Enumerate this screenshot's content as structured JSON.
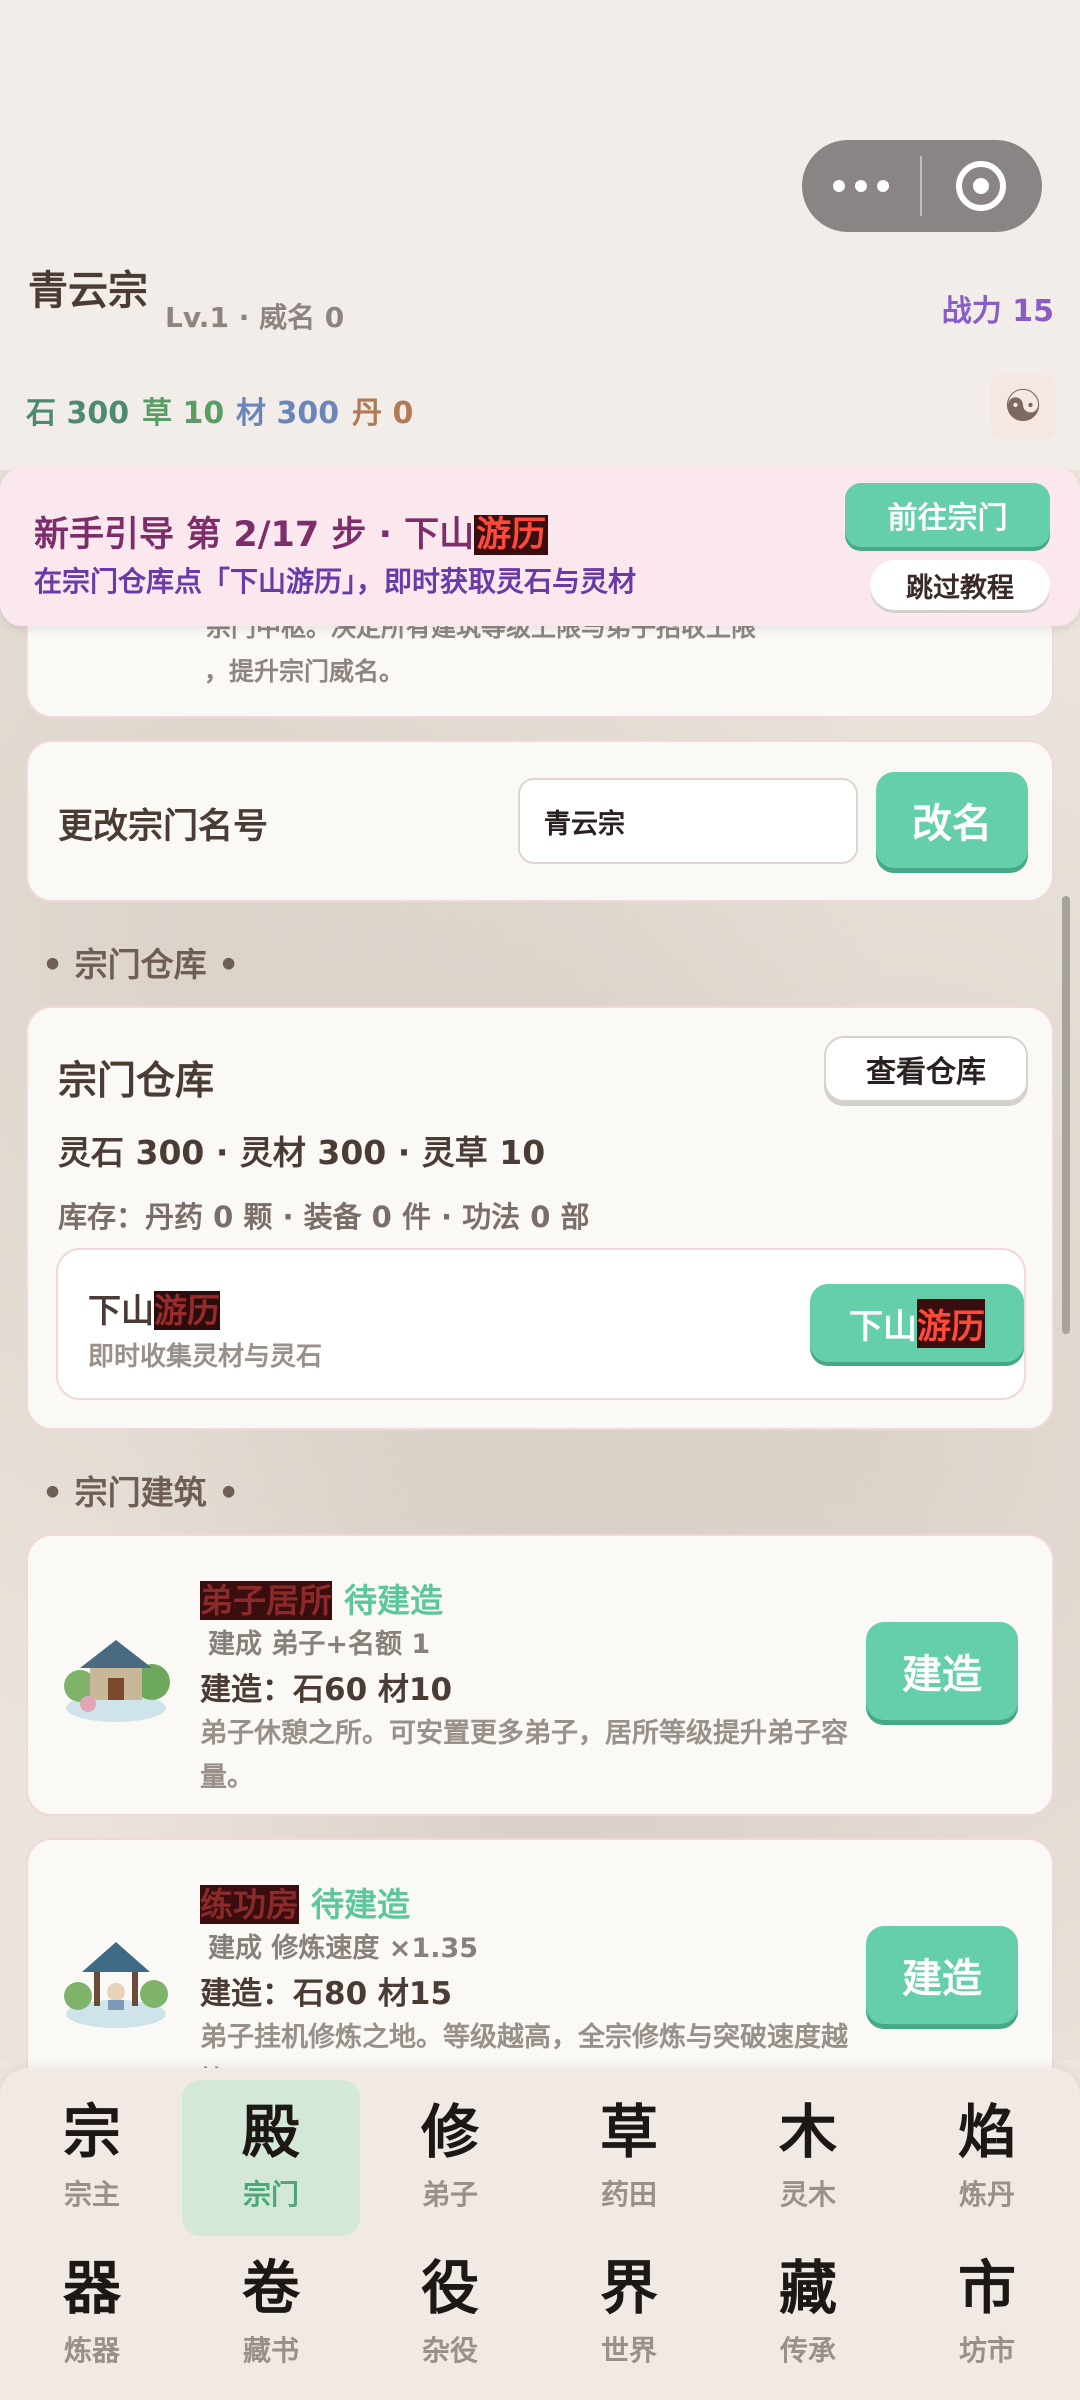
{
  "header": {
    "sect_name": "青云宗",
    "level_text": "Lv.1 · 威名 0",
    "power_text": "战力 15",
    "resources": {
      "stone": "石 300",
      "herb": "草 10",
      "material": "材 300",
      "pill": "丹 0"
    },
    "yinyang_glyph": "☯"
  },
  "guide": {
    "title_prefix": "新手引导 第 2/17 步 · 下山",
    "title_highlight": "游历",
    "subtitle": "在宗门仓库点「下山游历」，即时获取灵石与灵材",
    "goto_label": "前往宗门",
    "skip_label": "跳过教程"
  },
  "top_partial": {
    "line1": "宗门中枢。决定所有建筑等级上限与弟子招收上限",
    "line2": "，提升宗门威名。"
  },
  "rename": {
    "label": "更改宗门名号",
    "input_value": "青云宗",
    "button_label": "改名"
  },
  "warehouse_section": {
    "heading": "• 宗门仓库 •",
    "title": "宗门仓库",
    "view_button": "查看仓库",
    "resources_line": "灵石 300 · 灵材 300 · 灵草 10",
    "stock_line": "库存：丹药 0 颗 · 装备 0 件 · 功法 0 部",
    "expedition": {
      "title_prefix": "下山",
      "title_highlight": "游历",
      "subtitle": "即时收集灵材与灵石",
      "button_prefix": "下山",
      "button_highlight": "游历"
    }
  },
  "buildings_section": {
    "heading": "• 宗门建筑 •",
    "items": [
      {
        "name": "弟子居所",
        "state": "待建造",
        "effect": "建成 弟子+名额 1",
        "cost": "建造：石60 材10",
        "desc": "弟子休憩之所。可安置更多弟子，居所等级提升弟子容量。",
        "button": "建造"
      },
      {
        "name": "练功房",
        "state": "待建造",
        "effect": "建成 修炼速度 ×1.35",
        "cost": "建造：石80 材15",
        "desc": "弟子挂机修炼之地。等级越高，全宗修炼与突破速度越快。",
        "button": "建造"
      }
    ]
  },
  "nav": {
    "items": [
      {
        "glyph": "宗",
        "label": "宗主"
      },
      {
        "glyph": "殿",
        "label": "宗门"
      },
      {
        "glyph": "修",
        "label": "弟子"
      },
      {
        "glyph": "草",
        "label": "药田"
      },
      {
        "glyph": "木",
        "label": "灵木"
      },
      {
        "glyph": "焰",
        "label": "炼丹"
      },
      {
        "glyph": "器",
        "label": "炼器"
      },
      {
        "glyph": "卷",
        "label": "藏书"
      },
      {
        "glyph": "役",
        "label": "杂役"
      },
      {
        "glyph": "界",
        "label": "世界"
      },
      {
        "glyph": "藏",
        "label": "传承"
      },
      {
        "glyph": "市",
        "label": "坊市"
      }
    ],
    "active_index": 1
  },
  "colors": {
    "accent_green": "#64cfaa",
    "power_purple": "#8a5cc7",
    "guide_bg": "#fbe8ef"
  }
}
